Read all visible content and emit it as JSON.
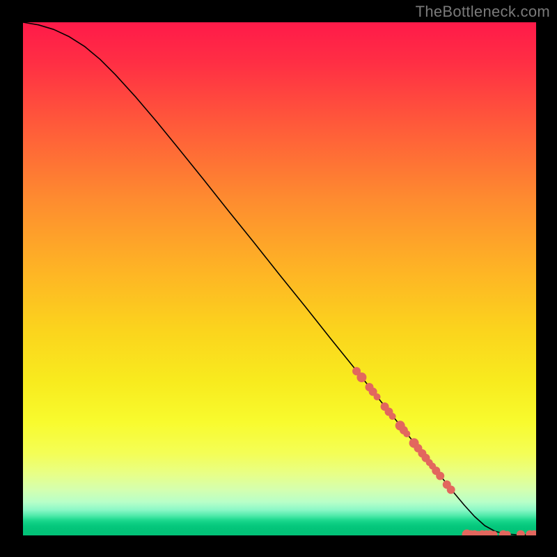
{
  "watermark": "TheBottleneck.com",
  "chart_data": {
    "type": "line",
    "title": "",
    "xlabel": "",
    "ylabel": "",
    "xlim": [
      0,
      100
    ],
    "ylim": [
      0,
      100
    ],
    "grid": false,
    "legend": false,
    "annotations": [
      {
        "text": "TheBottleneck.com",
        "position": "top-right",
        "color": "#7a7a7a"
      }
    ],
    "series": [
      {
        "name": "bottleneck-curve",
        "type": "line",
        "color": "#000000",
        "x": [
          0,
          3,
          6,
          9,
          12,
          15,
          18,
          22,
          26,
          30,
          35,
          40,
          45,
          50,
          55,
          60,
          65,
          70,
          75,
          80,
          82,
          84,
          86,
          88,
          90,
          92,
          94,
          96,
          98,
          100
        ],
        "y": [
          100,
          99.5,
          98.6,
          97.2,
          95.3,
          92.8,
          89.8,
          85.4,
          80.7,
          75.8,
          69.6,
          63.3,
          57.1,
          50.8,
          44.6,
          38.3,
          32.1,
          25.8,
          19.6,
          13.3,
          10.8,
          8.3,
          5.9,
          3.7,
          1.9,
          0.8,
          0.3,
          0.15,
          0.1,
          0.1
        ]
      },
      {
        "name": "highlighted-points",
        "type": "scatter",
        "color": "#e2675e",
        "radius_scale": [
          4,
          8
        ],
        "points": [
          {
            "x": 65.0,
            "y": 32.0,
            "r": 6
          },
          {
            "x": 66.0,
            "y": 30.8,
            "r": 7
          },
          {
            "x": 67.5,
            "y": 28.9,
            "r": 6
          },
          {
            "x": 68.2,
            "y": 28.0,
            "r": 6
          },
          {
            "x": 69.0,
            "y": 27.0,
            "r": 5
          },
          {
            "x": 70.5,
            "y": 25.1,
            "r": 6
          },
          {
            "x": 71.3,
            "y": 24.1,
            "r": 6
          },
          {
            "x": 72.0,
            "y": 23.2,
            "r": 5
          },
          {
            "x": 73.5,
            "y": 21.4,
            "r": 7
          },
          {
            "x": 74.2,
            "y": 20.5,
            "r": 6
          },
          {
            "x": 74.8,
            "y": 19.8,
            "r": 5
          },
          {
            "x": 76.2,
            "y": 18.0,
            "r": 7
          },
          {
            "x": 77.0,
            "y": 17.0,
            "r": 6
          },
          {
            "x": 77.8,
            "y": 16.0,
            "r": 6
          },
          {
            "x": 78.5,
            "y": 15.1,
            "r": 6
          },
          {
            "x": 79.2,
            "y": 14.2,
            "r": 5
          },
          {
            "x": 79.8,
            "y": 13.5,
            "r": 5
          },
          {
            "x": 80.5,
            "y": 12.6,
            "r": 6
          },
          {
            "x": 81.3,
            "y": 11.6,
            "r": 6
          },
          {
            "x": 82.6,
            "y": 9.9,
            "r": 6
          },
          {
            "x": 83.4,
            "y": 8.9,
            "r": 6
          },
          {
            "x": 86.5,
            "y": 0.2,
            "r": 7
          },
          {
            "x": 87.3,
            "y": 0.2,
            "r": 6
          },
          {
            "x": 88.0,
            "y": 0.2,
            "r": 6
          },
          {
            "x": 88.7,
            "y": 0.2,
            "r": 5
          },
          {
            "x": 89.5,
            "y": 0.2,
            "r": 6
          },
          {
            "x": 90.3,
            "y": 0.2,
            "r": 6
          },
          {
            "x": 91.0,
            "y": 0.2,
            "r": 6
          },
          {
            "x": 91.8,
            "y": 0.2,
            "r": 5
          },
          {
            "x": 93.6,
            "y": 0.2,
            "r": 6
          },
          {
            "x": 94.4,
            "y": 0.2,
            "r": 5
          },
          {
            "x": 97.0,
            "y": 0.2,
            "r": 6
          },
          {
            "x": 98.8,
            "y": 0.2,
            "r": 6
          },
          {
            "x": 99.6,
            "y": 0.2,
            "r": 6
          }
        ]
      }
    ],
    "background_gradient": {
      "direction": "vertical",
      "stops": [
        {
          "pos": 0.0,
          "color": "#ff1a49"
        },
        {
          "pos": 0.35,
          "color": "#fe8d2f"
        },
        {
          "pos": 0.7,
          "color": "#f8eb1e"
        },
        {
          "pos": 0.9,
          "color": "#d5ffae"
        },
        {
          "pos": 1.0,
          "color": "#02c278"
        }
      ]
    }
  }
}
